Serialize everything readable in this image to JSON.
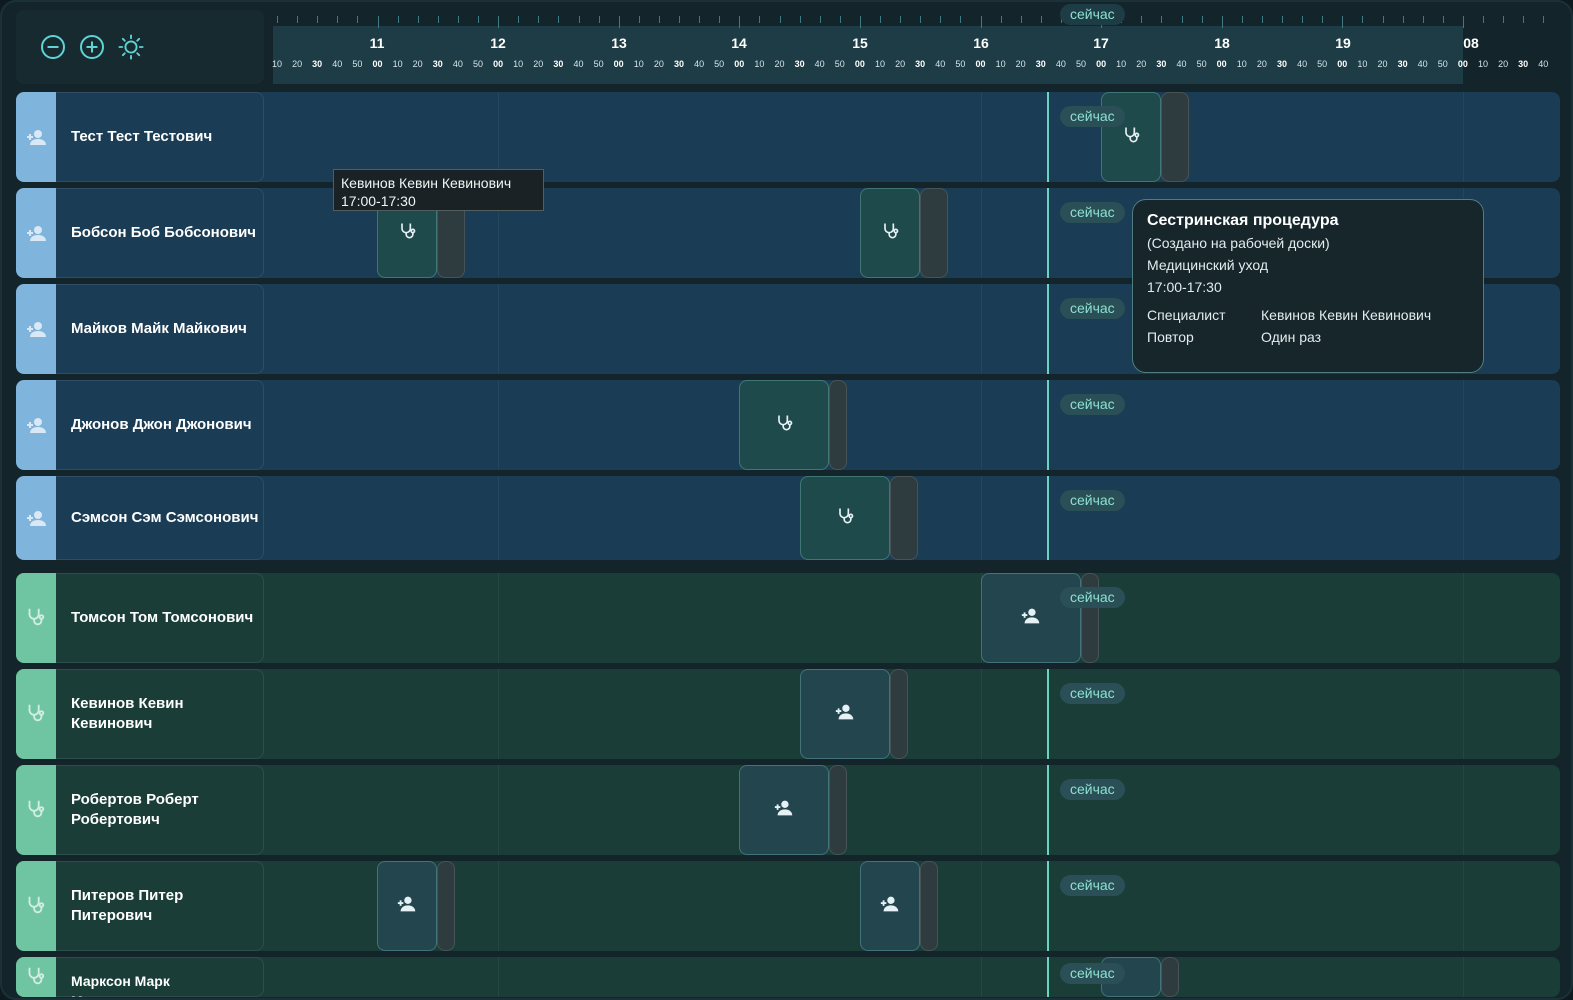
{
  "controls": {
    "zoom_out": "zoom-out-icon",
    "zoom_in": "zoom-in-icon",
    "theme": "sun-icon"
  },
  "ruler": {
    "hours": [
      "11",
      "12",
      "13",
      "14",
      "15",
      "16",
      "17",
      "18",
      "19",
      "08"
    ],
    "minutes": [
      "10",
      "20",
      "30",
      "40",
      "50",
      "00"
    ],
    "now_label": "сейчас"
  },
  "now_label": "сейчас",
  "rows": [
    {
      "name": "Тест Тест Тестович",
      "group": "patients"
    },
    {
      "name": "Бобсон Боб Бобсонович",
      "group": "patients"
    },
    {
      "name": "Майков Майк Майкович",
      "group": "patients"
    },
    {
      "name": "Джонов Джон Джонович",
      "group": "patients"
    },
    {
      "name": "Сэмсон Сэм Сэмсонович",
      "group": "patients"
    },
    {
      "name": "Томсон Том Томсонович",
      "group": "specialists"
    },
    {
      "name": "Кевинов Кевин Кевинович",
      "group": "specialists"
    },
    {
      "name": "Робертов Роберт Робертович",
      "group": "specialists"
    },
    {
      "name": "Питеров Питер Питерович",
      "group": "specialists"
    },
    {
      "name": "Марксон Марк Марксонович",
      "group": "specialists"
    }
  ],
  "mini_tooltip": {
    "name": "Кевинов Кевин Кевинович",
    "time": "17:00-17:30"
  },
  "detail_tooltip": {
    "title": "Сестринская процедура",
    "subtitle": "(Создано на рабочей доски)",
    "category": "Медицинский уход",
    "time": "17:00-17:30",
    "specialist_label": "Специалист",
    "specialist_value": "Кевинов Кевин Кевинович",
    "repeat_label": "Повтор",
    "repeat_value": "Один раз"
  },
  "colors": {
    "patient_stripe": "#7fb4dc",
    "specialist_stripe": "#6fc4a1",
    "now_line": "#6ad4c0"
  }
}
